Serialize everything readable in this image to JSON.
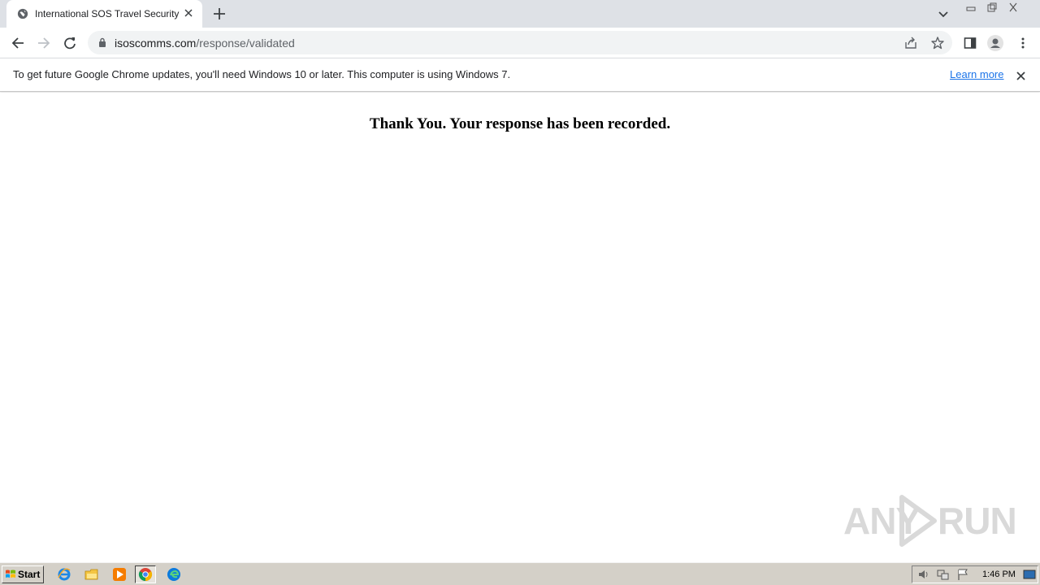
{
  "browser": {
    "tab": {
      "title": "International SOS Travel Security"
    },
    "url": {
      "domain": "isoscomms.com",
      "path": "/response/validated"
    }
  },
  "infobar": {
    "message": "To get future Google Chrome updates, you'll need Windows 10 or later. This computer is using Windows 7.",
    "learn_more": "Learn more"
  },
  "page": {
    "heading": "Thank You. Your response has been recorded."
  },
  "watermark": {
    "left": "ANY",
    "right": "RUN"
  },
  "taskbar": {
    "start_label": "Start",
    "apps": [
      "internet-explorer-icon",
      "file-explorer-icon",
      "media-player-icon",
      "chrome-icon",
      "edge-icon"
    ],
    "clock": "1:46 PM"
  }
}
